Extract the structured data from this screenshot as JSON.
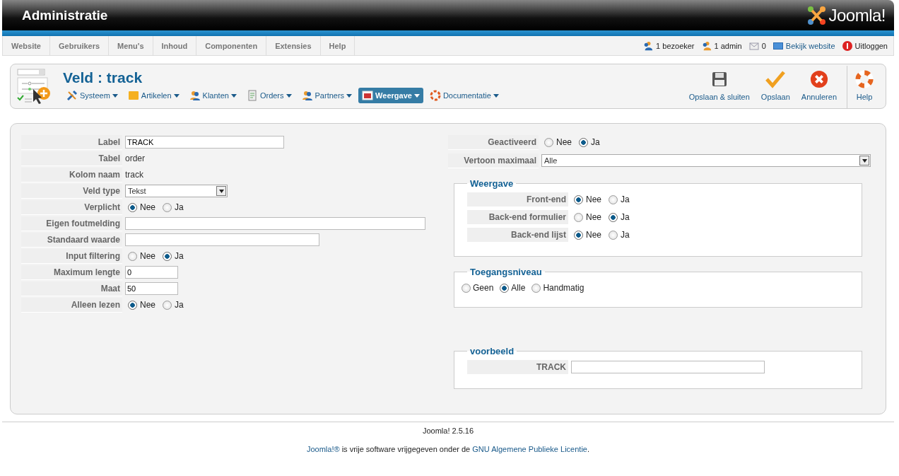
{
  "header": {
    "title": "Administratie",
    "logo": "Joomla!"
  },
  "menu": [
    "Website",
    "Gebruikers",
    "Menu's",
    "Inhoud",
    "Componenten",
    "Extensies",
    "Help"
  ],
  "status": [
    {
      "kind": "visitors",
      "label": "1 bezoeker"
    },
    {
      "kind": "admins",
      "label": "1 admin"
    },
    {
      "kind": "messages",
      "label": "0"
    },
    {
      "kind": "view-site",
      "label": "Bekijk website"
    },
    {
      "kind": "logout",
      "label": "Uitloggen"
    }
  ],
  "toolbar": {
    "title": "Veld : track",
    "submenu": [
      {
        "kind": "tools",
        "label": "Systeem",
        "selected": false
      },
      {
        "kind": "folder",
        "label": "Artikelen",
        "selected": false
      },
      {
        "kind": "users",
        "label": "Klanten",
        "selected": false
      },
      {
        "kind": "document",
        "label": "Orders",
        "selected": false
      },
      {
        "kind": "partners",
        "label": "Partners",
        "selected": false
      },
      {
        "kind": "window",
        "label": "Weergave",
        "selected": true
      },
      {
        "kind": "lifebuoy",
        "label": "Documentatie",
        "selected": false
      }
    ],
    "actions": [
      {
        "kind": "save",
        "label": "Opslaan & sluiten"
      },
      {
        "kind": "check",
        "label": "Opslaan"
      },
      {
        "kind": "cancel",
        "label": "Annuleren"
      },
      {
        "kind": "help",
        "label": "Help"
      }
    ]
  },
  "left_fields": [
    {
      "kind": "input",
      "label": "Label",
      "value": "TRACK"
    },
    {
      "kind": "static",
      "label": "Tabel",
      "value": "order"
    },
    {
      "kind": "static",
      "label": "Kolom naam",
      "value": "track"
    },
    {
      "kind": "select",
      "label": "Veld type",
      "value": "Tekst"
    },
    {
      "kind": "radio",
      "label": "Verplicht",
      "options": [
        {
          "label": "Nee",
          "selected": true
        },
        {
          "label": "Ja",
          "selected": false
        }
      ]
    },
    {
      "kind": "input",
      "label": "Eigen foutmelding"
    },
    {
      "kind": "input",
      "label": "Standaard waarde"
    },
    {
      "kind": "radio",
      "label": "Input filtering",
      "options": [
        {
          "label": "Nee",
          "selected": false
        },
        {
          "label": "Ja",
          "selected": true
        }
      ]
    },
    {
      "kind": "input",
      "label": "Maximum lengte",
      "value": "0"
    },
    {
      "kind": "input",
      "label": "Maat",
      "value": "50"
    },
    {
      "kind": "radio",
      "label": "Alleen lezen",
      "options": [
        {
          "label": "Nee",
          "selected": true
        },
        {
          "label": "Ja",
          "selected": false
        }
      ]
    }
  ],
  "right_fields": [
    {
      "kind": "radio",
      "label": "Geactiveerd",
      "options": [
        {
          "label": "Nee",
          "selected": false
        },
        {
          "label": "Ja",
          "selected": true
        }
      ]
    },
    {
      "kind": "select",
      "label": "Vertoon maximaal",
      "value": "Alle"
    }
  ],
  "weergave": {
    "legend": "Weergave",
    "fields": [
      {
        "kind": "radio",
        "label": "Front-end",
        "options": [
          {
            "label": "Nee",
            "selected": true
          },
          {
            "label": "Ja",
            "selected": false
          }
        ]
      },
      {
        "kind": "radio",
        "label": "Back-end formulier",
        "options": [
          {
            "label": "Nee",
            "selected": false
          },
          {
            "label": "Ja",
            "selected": true
          }
        ]
      },
      {
        "kind": "radio",
        "label": "Back-end lijst",
        "options": [
          {
            "label": "Nee",
            "selected": true
          },
          {
            "label": "Ja",
            "selected": false
          }
        ]
      }
    ]
  },
  "toegang": {
    "legend": "Toegangsniveau",
    "options": [
      {
        "label": "Geen",
        "selected": false
      },
      {
        "label": "Alle",
        "selected": true
      },
      {
        "label": "Handmatig",
        "selected": false
      }
    ]
  },
  "voorbeeld": {
    "legend": "voorbeeld",
    "fields": [
      {
        "kind": "input",
        "label": "TRACK"
      }
    ]
  },
  "footer": {
    "version": "Joomla! 2.5.16",
    "license": [
      {
        "kind": "link",
        "text": "Joomla!®"
      },
      {
        "kind": "text",
        "text": " is vrije software vrijgegeven onder de "
      },
      {
        "kind": "link",
        "text": "GNU Algemene Publieke Licentie"
      },
      {
        "kind": "text",
        "text": "."
      }
    ]
  }
}
